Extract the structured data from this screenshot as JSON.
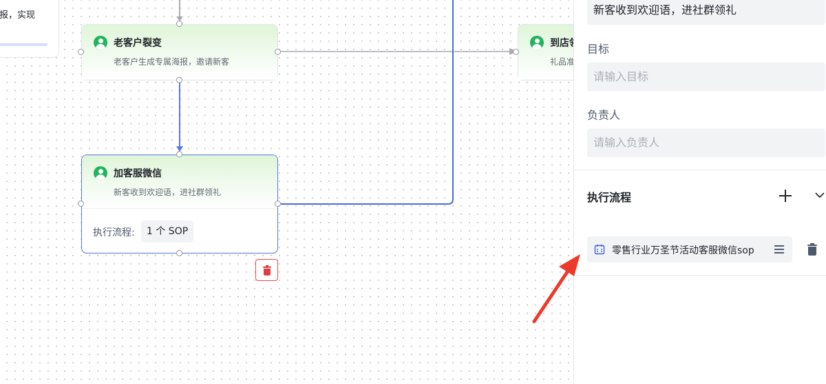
{
  "canvas": {
    "partial_card_text": "报，实现",
    "nodes": [
      {
        "title": "老客户裂变",
        "desc": "老客户生成专属海报，邀请新客"
      },
      {
        "title": "加客服微信",
        "desc": "新客收到欢迎语，进社群领礼",
        "exec_label": "执行流程:",
        "exec_value": "1 个 SOP"
      },
      {
        "title": "到店领",
        "desc": "礼品准"
      }
    ]
  },
  "panel": {
    "description_value": "新客收到欢迎语，进社群领礼",
    "goal_label": "目标",
    "goal_placeholder": "请输入目标",
    "owner_label": "负责人",
    "owner_placeholder": "请输入负责人",
    "section_title": "执行流程",
    "sop_items": [
      {
        "label": "零售行业万圣节活动客服微信sop"
      }
    ]
  },
  "colors": {
    "accent": "#5578e0",
    "node_icon": "#22b35e",
    "danger": "#e23c3c",
    "annotation_arrow": "#ec3b2a"
  },
  "icons": [
    "user-circle-icon",
    "trash-icon",
    "plus-icon",
    "chevron-down-icon",
    "calendar-icon",
    "drag-handle-icon"
  ]
}
